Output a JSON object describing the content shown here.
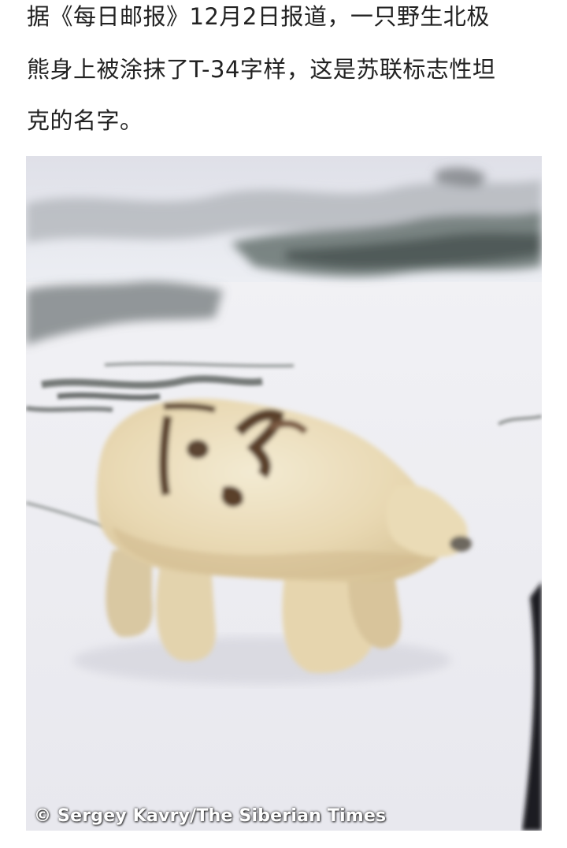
{
  "article": {
    "paragraph_lines": [
      "据《每日邮报》12月2日报道，一只野生北极",
      "熊身上被涂抹了T-34字样，这是苏联标志性坦",
      "克的名字。"
    ],
    "image": {
      "subject": "polar bear with T-34 marking",
      "credit": "© Sergey Kavry/The Siberian Times"
    }
  }
}
